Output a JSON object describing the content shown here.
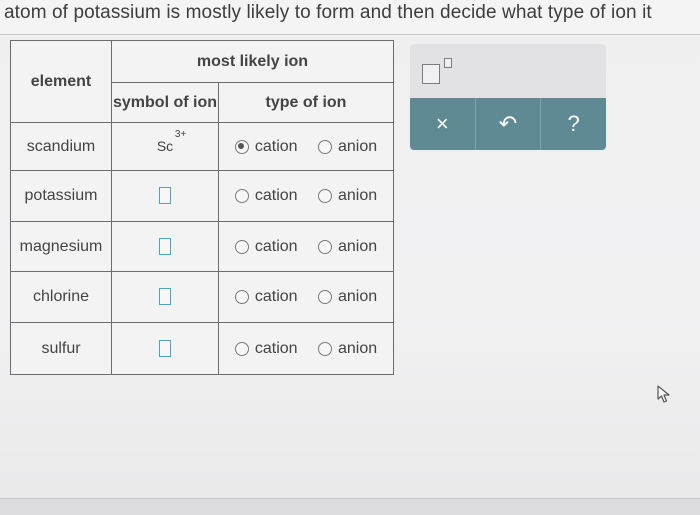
{
  "instruction": "atom of potassium is mostly likely to form and then decide what type of ion it",
  "table": {
    "header_element": "element",
    "header_most_likely_ion": "most likely ion",
    "header_symbol": "symbol of ion",
    "header_type": "type of ion",
    "option_cation": "cation",
    "option_anion": "anion",
    "rows": [
      {
        "element": "scandium",
        "symbol": "Sc",
        "charge": "3+",
        "selected": "cation"
      },
      {
        "element": "potassium",
        "symbol": "",
        "charge": "",
        "selected": ""
      },
      {
        "element": "magnesium",
        "symbol": "",
        "charge": "",
        "selected": ""
      },
      {
        "element": "chlorine",
        "symbol": "",
        "charge": "",
        "selected": ""
      },
      {
        "element": "sulfur",
        "symbol": "",
        "charge": "",
        "selected": ""
      }
    ]
  },
  "tools": {
    "superscript_icon": "superscript-box-icon",
    "clear_label": "×",
    "undo_label": "↶",
    "help_label": "?"
  },
  "colors": {
    "toolbar": "#5f8a93",
    "input_border": "#4aa6c8"
  }
}
